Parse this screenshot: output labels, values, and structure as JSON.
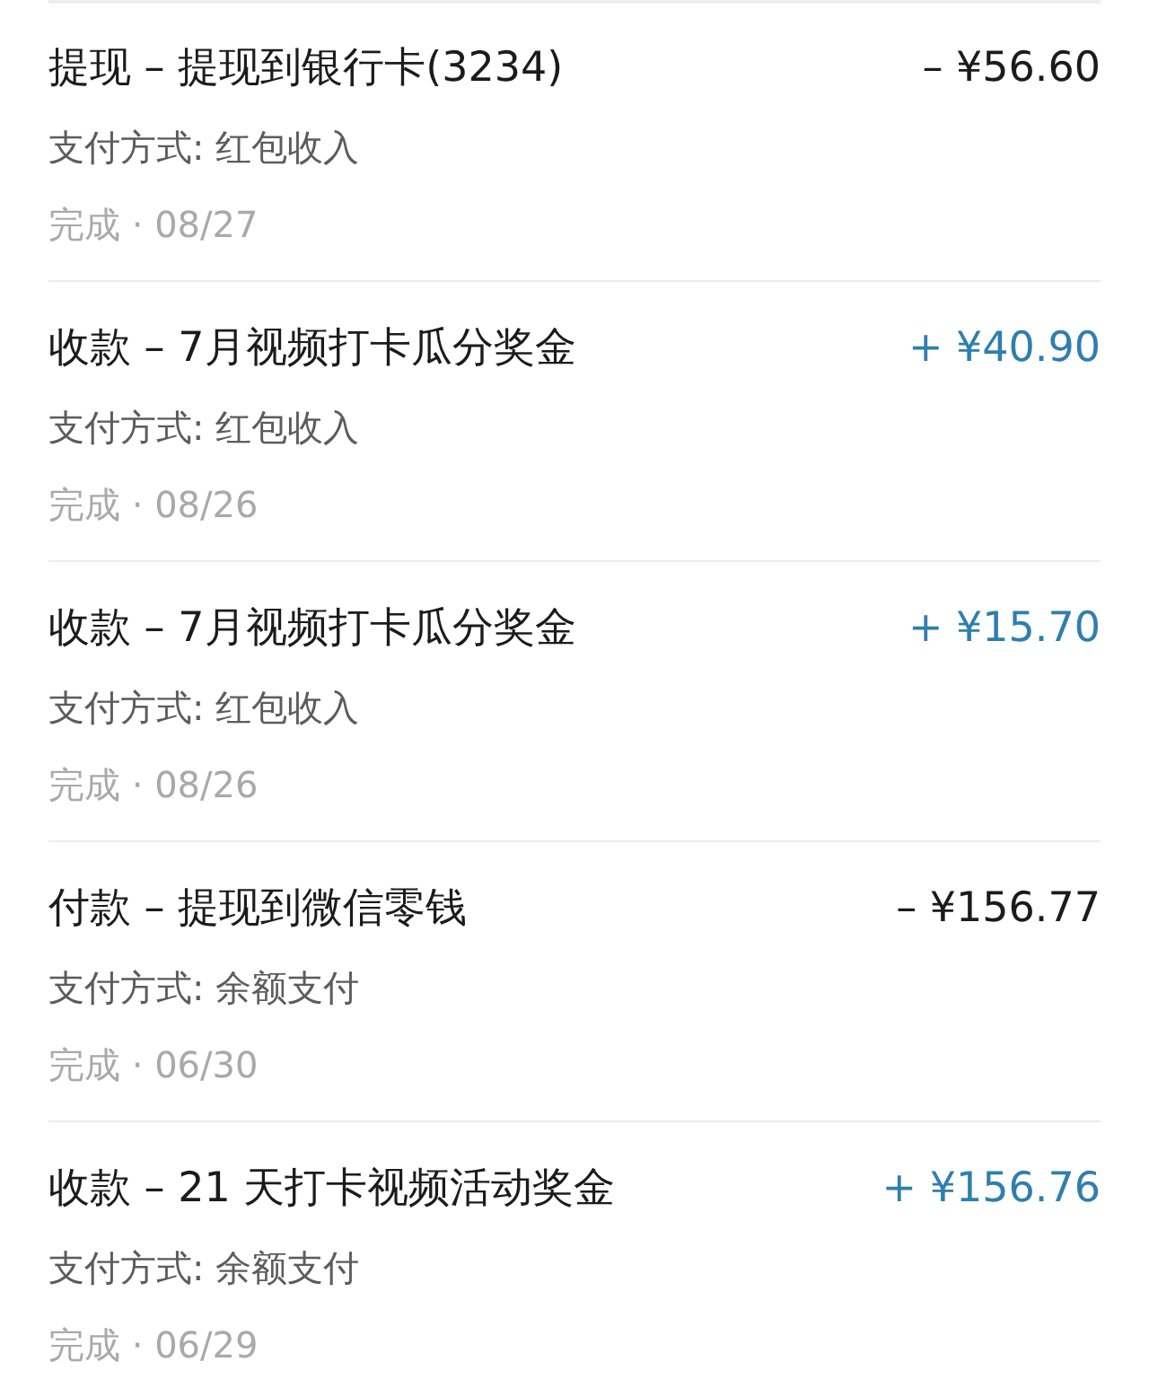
{
  "transactions": [
    {
      "title": "提现 – 提现到银行卡(3234)",
      "amount": "– ¥56.60",
      "kind": "expense",
      "method": "支付方式: 红包收入",
      "status": "完成 · 08/27"
    },
    {
      "title": "收款 – 7月视频打卡瓜分奖金",
      "amount": "+ ¥40.90",
      "kind": "income",
      "method": "支付方式: 红包收入",
      "status": "完成 · 08/26"
    },
    {
      "title": "收款 – 7月视频打卡瓜分奖金",
      "amount": "+ ¥15.70",
      "kind": "income",
      "method": "支付方式: 红包收入",
      "status": "完成 · 08/26"
    },
    {
      "title": "付款 – 提现到微信零钱",
      "amount": "– ¥156.77",
      "kind": "expense",
      "method": "支付方式: 余额支付",
      "status": "完成 · 06/30"
    },
    {
      "title": "收款 – 21 天打卡视频活动奖金",
      "amount": "+ ¥156.76",
      "kind": "income",
      "method": "支付方式: 余额支付",
      "status": "完成 · 06/29"
    }
  ]
}
